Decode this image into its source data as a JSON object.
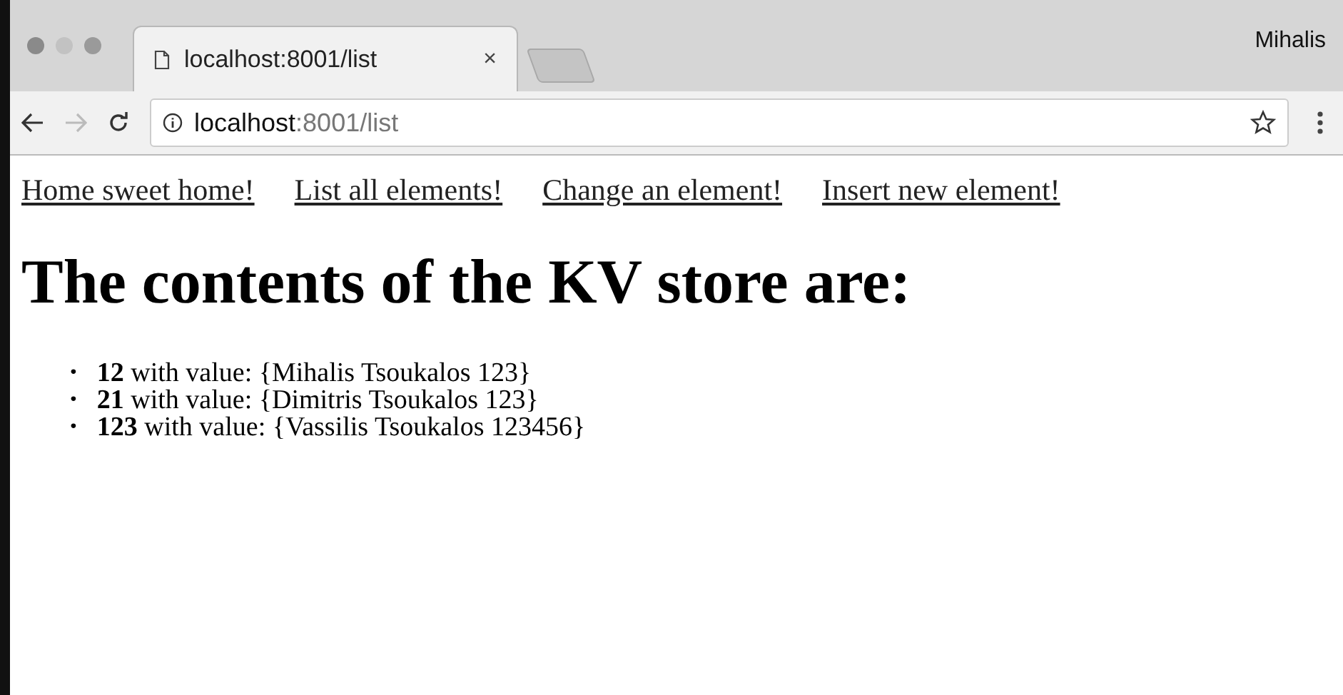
{
  "window": {
    "user": "Mihalis"
  },
  "tabs": [
    {
      "title": "localhost:8001/list",
      "close": "×",
      "selected": true
    }
  ],
  "nav_buttons": [
    {
      "kind": "back",
      "disabled": false
    },
    {
      "kind": "forward",
      "disabled": true
    },
    {
      "kind": "reload",
      "disabled": false
    }
  ],
  "address": {
    "host": "localhost",
    "rest": ":8001/list"
  },
  "page": {
    "links": [
      "Home sweet home!",
      "List all elements!",
      "Change an element!",
      "Insert new element!"
    ],
    "heading": "The contents of the KV store are:",
    "items": [
      {
        "bullet": "•",
        "text": "**12** with value: {Mihalis Tsoukalos 123}"
      },
      {
        "bullet": "•",
        "text": "**21** with value: {Dimitris Tsoukalos 123}"
      },
      {
        "bullet": "•",
        "text": "**123** with value: {Vassilis Tsoukalos 123456}"
      }
    ]
  }
}
